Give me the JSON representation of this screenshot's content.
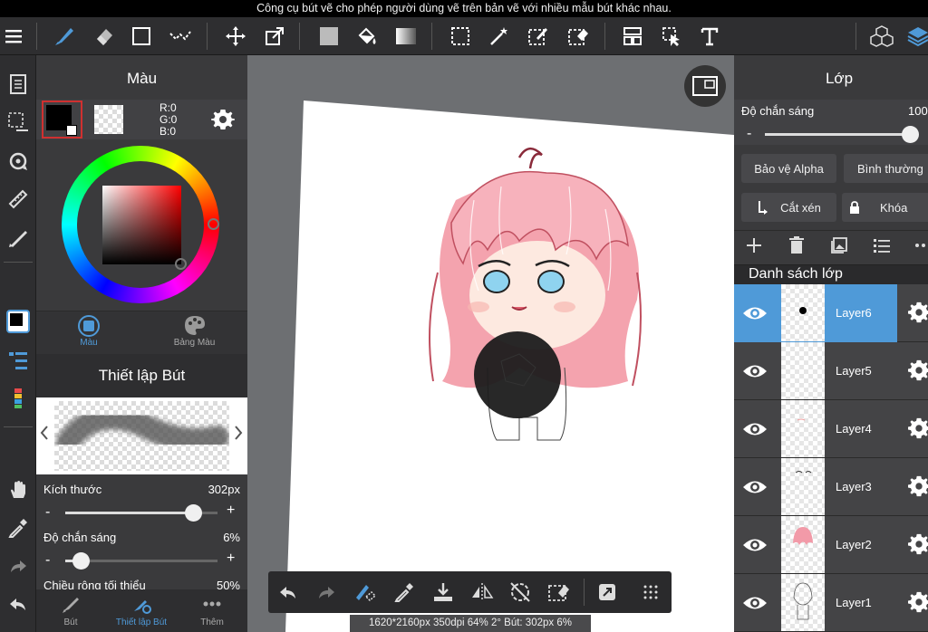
{
  "caption": "Công cụ bút vẽ cho phép người dùng vẽ trên bản vẽ với nhiều mẫu bút khác nhau.",
  "color_panel": {
    "title": "Màu",
    "rgb": {
      "r": "R:0",
      "g": "G:0",
      "b": "B:0"
    },
    "tab_color": "Màu",
    "tab_palette": "Bảng Màu",
    "primary_color": "#000000"
  },
  "brush_settings": {
    "title": "Thiết lập Bút",
    "size_label": "Kích thước",
    "size_value": "302px",
    "size_level": 0.84,
    "opacity_label": "Độ chắn sáng",
    "opacity_value": "6%",
    "opacity_level": 0.06,
    "min_width_label": "Chiều rộng tối thiểu",
    "min_width_value": "50%"
  },
  "bottom_tabs": {
    "brush": "Bút",
    "brush_settings": "Thiết lập Bút",
    "more": "Thêm"
  },
  "layer_panel": {
    "title": "Lớp",
    "opacity_label": "Độ chắn sáng",
    "opacity_value": "100",
    "opacity_level": 1.0,
    "alpha_protect": "Bảo vệ Alpha",
    "blend_mode": "Bình thường",
    "clipping": "Cắt xén",
    "lock": "Khóa",
    "list_title": "Danh sách lớp",
    "layers": [
      {
        "name": "Layer6",
        "selected": true
      },
      {
        "name": "Layer5",
        "selected": false
      },
      {
        "name": "Layer4",
        "selected": false
      },
      {
        "name": "Layer3",
        "selected": false
      },
      {
        "name": "Layer2",
        "selected": false
      },
      {
        "name": "Layer1",
        "selected": false
      }
    ]
  },
  "status_bar": "1620*2160px 350dpi 64% 2° Bút: 302px 6%",
  "colors": {
    "accent": "#4f9ad8",
    "panel": "#3a3a3c",
    "toolbar": "#2e2e30"
  }
}
